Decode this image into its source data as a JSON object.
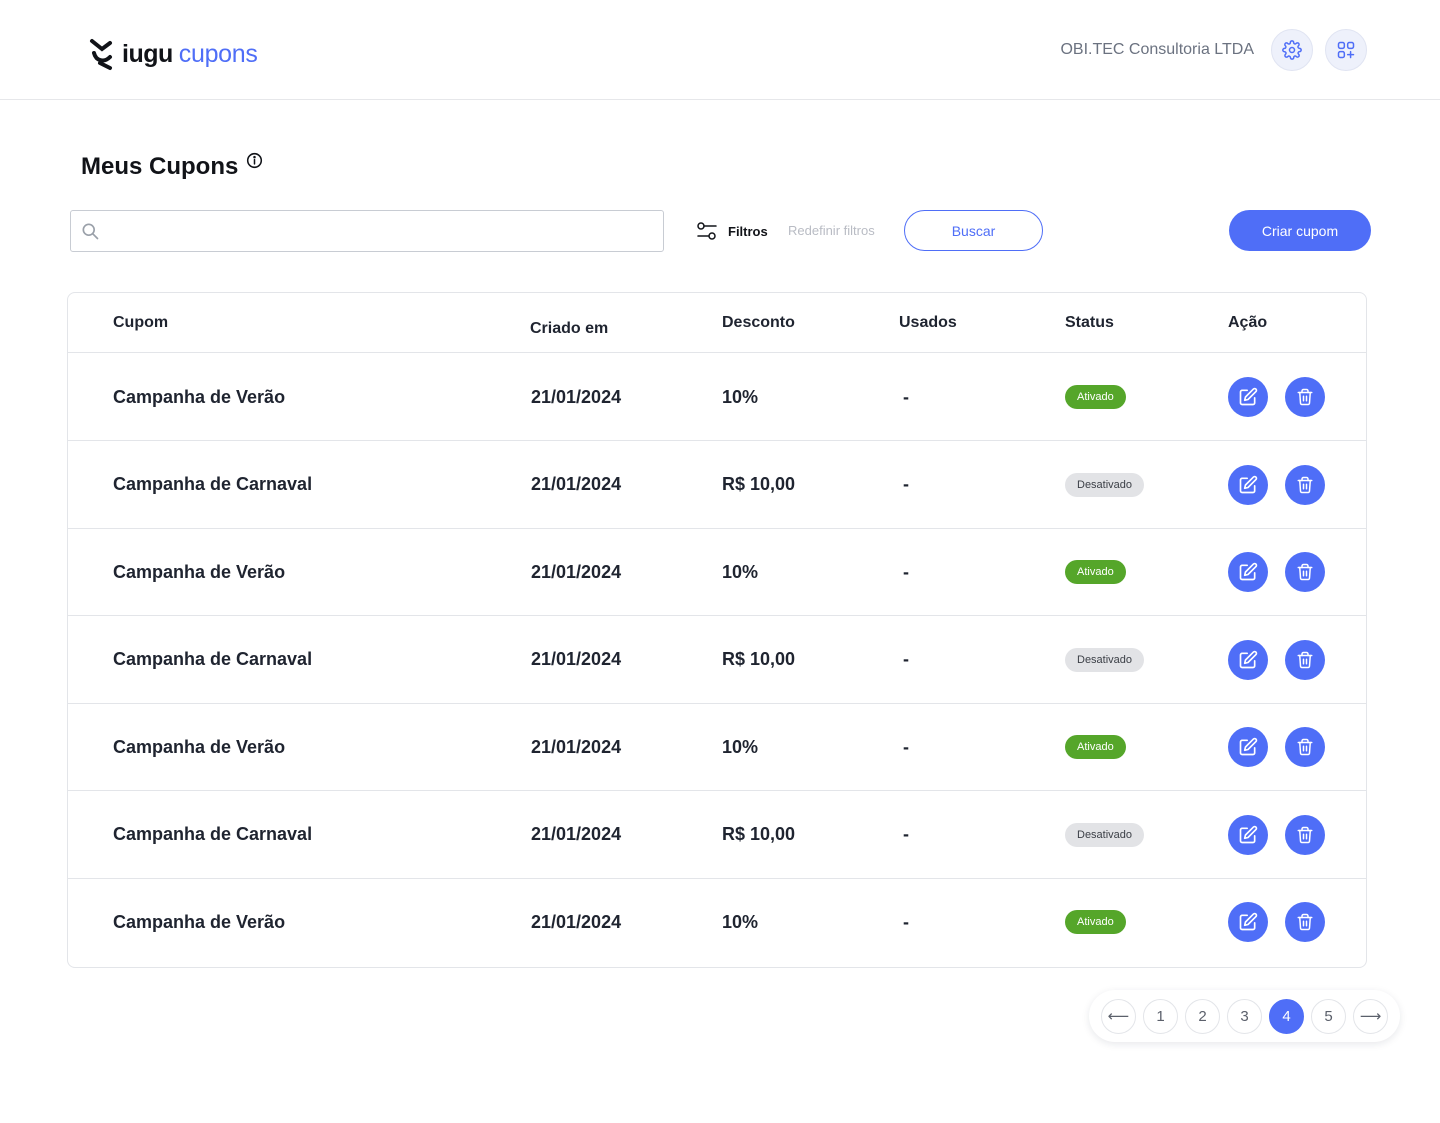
{
  "header": {
    "logo_dark": "iugu",
    "logo_blue": "cupons",
    "company": "OBI.TEC Consultoria LTDA",
    "settings_icon": "gear-icon",
    "apps_icon": "apps-add-icon"
  },
  "page": {
    "title": "Meus Cupons"
  },
  "toolbar": {
    "search_value": "",
    "filters_label": "Filtros",
    "reset_label": "Redefinir filtros",
    "search_button": "Buscar",
    "create_button": "Criar cupom"
  },
  "table": {
    "columns": [
      "Cupom",
      "Criado em",
      "Desconto",
      "Usados",
      "Status",
      "Ação"
    ],
    "rows": [
      {
        "name": "Campanha de Verão",
        "created": "21/01/2024",
        "discount": "10%",
        "used": "-",
        "status": "Ativado",
        "active": true
      },
      {
        "name": "Campanha de Carnaval",
        "created": "21/01/2024",
        "discount": "R$ 10,00",
        "used": "-",
        "status": "Desativado",
        "active": false
      },
      {
        "name": "Campanha de Verão",
        "created": "21/01/2024",
        "discount": "10%",
        "used": "-",
        "status": "Ativado",
        "active": true
      },
      {
        "name": "Campanha de Carnaval",
        "created": "21/01/2024",
        "discount": "R$ 10,00",
        "used": "-",
        "status": "Desativado",
        "active": false
      },
      {
        "name": "Campanha de Verão",
        "created": "21/01/2024",
        "discount": "10%",
        "used": "-",
        "status": "Ativado",
        "active": true
      },
      {
        "name": "Campanha de Carnaval",
        "created": "21/01/2024",
        "discount": "R$ 10,00",
        "used": "-",
        "status": "Desativado",
        "active": false
      },
      {
        "name": "Campanha de Verão",
        "created": "21/01/2024",
        "discount": "10%",
        "used": "-",
        "status": "Ativado",
        "active": true
      }
    ]
  },
  "pagination": {
    "prev": "⟵",
    "next": "⟶",
    "pages": [
      "1",
      "2",
      "3",
      "4",
      "5"
    ],
    "current": "4"
  },
  "colors": {
    "accent": "#4f6ef7",
    "active_badge": "#55a62a",
    "inactive_badge": "#e2e3e6"
  }
}
